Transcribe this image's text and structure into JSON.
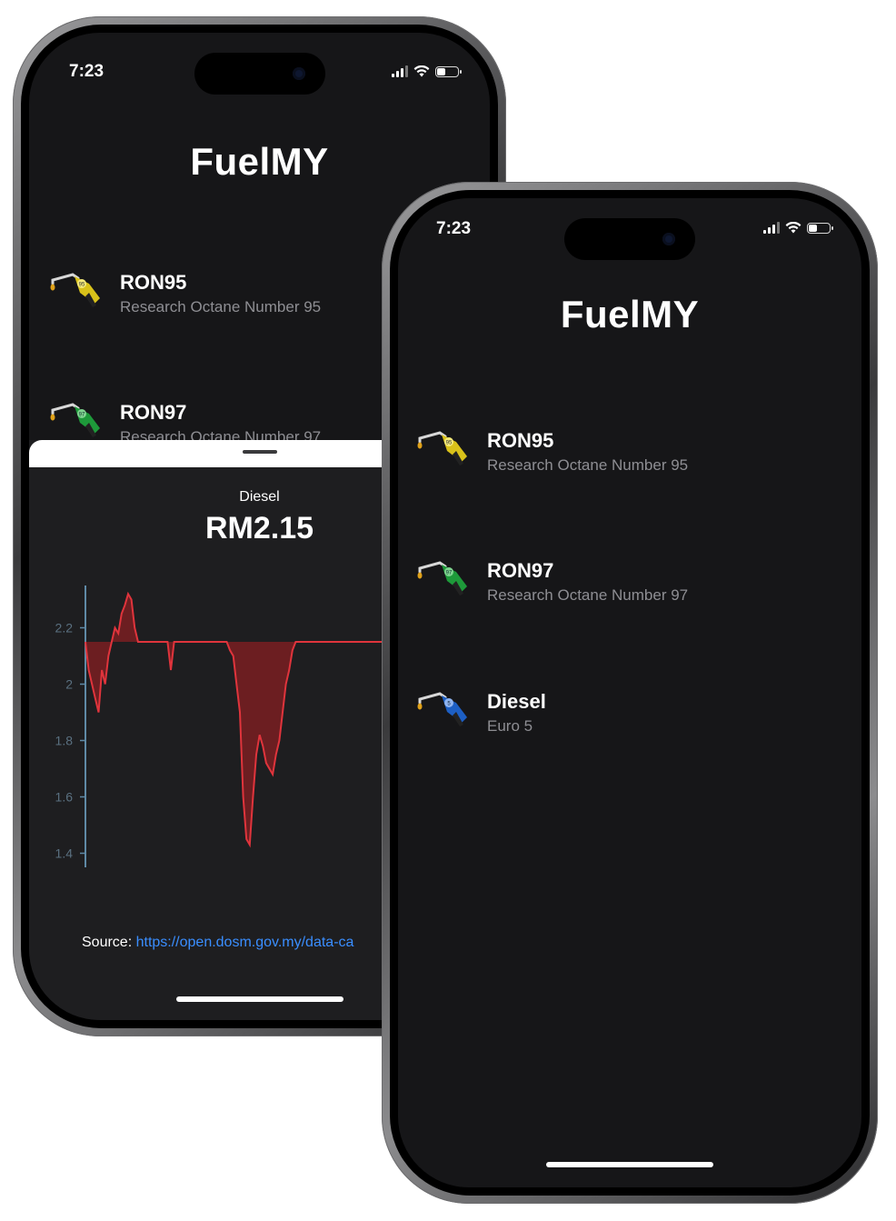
{
  "back_phone": {
    "status": {
      "time": "7:23"
    },
    "app_title": "FuelMY",
    "fuels": [
      {
        "name": "RON95",
        "desc": "Research Octane Number 95",
        "badge": "95",
        "color": "#d9c21a"
      },
      {
        "name": "RON97",
        "desc": "Research Octane Number 97",
        "badge": "97",
        "color": "#1e9a3a"
      }
    ],
    "sheet": {
      "fuel_label": "Diesel",
      "price": "RM2.15",
      "source_label": "Source:",
      "source_link": "https://open.dosm.gov.my/data-ca"
    }
  },
  "front_phone": {
    "status": {
      "time": "7:23"
    },
    "app_title": "FuelMY",
    "fuels": [
      {
        "name": "RON95",
        "desc": "Research Octane Number 95",
        "badge": "95",
        "color": "#d9c21a"
      },
      {
        "name": "RON97",
        "desc": "Research Octane Number 97",
        "badge": "97",
        "color": "#1e9a3a"
      },
      {
        "name": "Diesel",
        "desc": "Euro 5",
        "badge": "5",
        "color": "#1d5fc4"
      }
    ]
  },
  "chart_data": {
    "type": "area",
    "title": "",
    "xlabel": "",
    "ylabel": "",
    "ylim": [
      1.35,
      2.35
    ],
    "yticks": [
      "2.2",
      "2",
      "1.8",
      "1.6",
      "1.4"
    ],
    "grid": false,
    "series": [
      {
        "color": "#e0343c",
        "x": [
          0,
          1,
          2,
          3,
          4,
          5,
          6,
          7,
          8,
          9,
          10,
          11,
          12,
          13,
          14,
          15,
          16,
          17,
          18,
          19,
          20,
          21,
          22,
          23,
          24,
          25,
          26,
          27,
          28,
          29,
          30,
          31,
          32,
          33,
          34,
          35,
          36,
          37,
          38,
          39,
          40,
          41,
          42,
          43,
          44,
          45,
          46,
          47,
          48,
          49,
          50,
          51,
          52,
          53,
          54,
          55,
          56,
          57,
          58,
          59,
          60,
          61,
          62,
          63,
          64,
          65,
          66,
          67,
          68,
          69,
          70,
          71,
          72,
          73,
          74,
          75,
          76,
          77,
          78,
          79,
          80,
          81,
          82,
          83,
          84,
          85,
          86,
          87,
          88,
          89,
          90,
          91,
          92,
          93,
          94,
          95,
          96,
          97,
          98,
          99
        ],
        "values": [
          2.15,
          2.05,
          2.0,
          1.95,
          1.9,
          2.05,
          2.0,
          2.1,
          2.15,
          2.2,
          2.18,
          2.25,
          2.28,
          2.32,
          2.3,
          2.2,
          2.15,
          2.15,
          2.15,
          2.15,
          2.15,
          2.15,
          2.15,
          2.15,
          2.15,
          2.15,
          2.05,
          2.15,
          2.15,
          2.15,
          2.15,
          2.15,
          2.15,
          2.15,
          2.15,
          2.15,
          2.15,
          2.15,
          2.15,
          2.15,
          2.15,
          2.15,
          2.15,
          2.15,
          2.12,
          2.1,
          2.0,
          1.9,
          1.6,
          1.45,
          1.43,
          1.6,
          1.75,
          1.82,
          1.78,
          1.72,
          1.7,
          1.68,
          1.75,
          1.8,
          1.9,
          2.0,
          2.05,
          2.12,
          2.15,
          2.15,
          2.15,
          2.15,
          2.15,
          2.15,
          2.15,
          2.15,
          2.15,
          2.15,
          2.15,
          2.15,
          2.15,
          2.15,
          2.15,
          2.15,
          2.15,
          2.15,
          2.15,
          2.15,
          2.15,
          2.15,
          2.15,
          2.15,
          2.15,
          2.15,
          2.15,
          2.15,
          2.15,
          2.15,
          2.15,
          2.15,
          2.15,
          2.15,
          2.15,
          2.15
        ]
      }
    ]
  }
}
